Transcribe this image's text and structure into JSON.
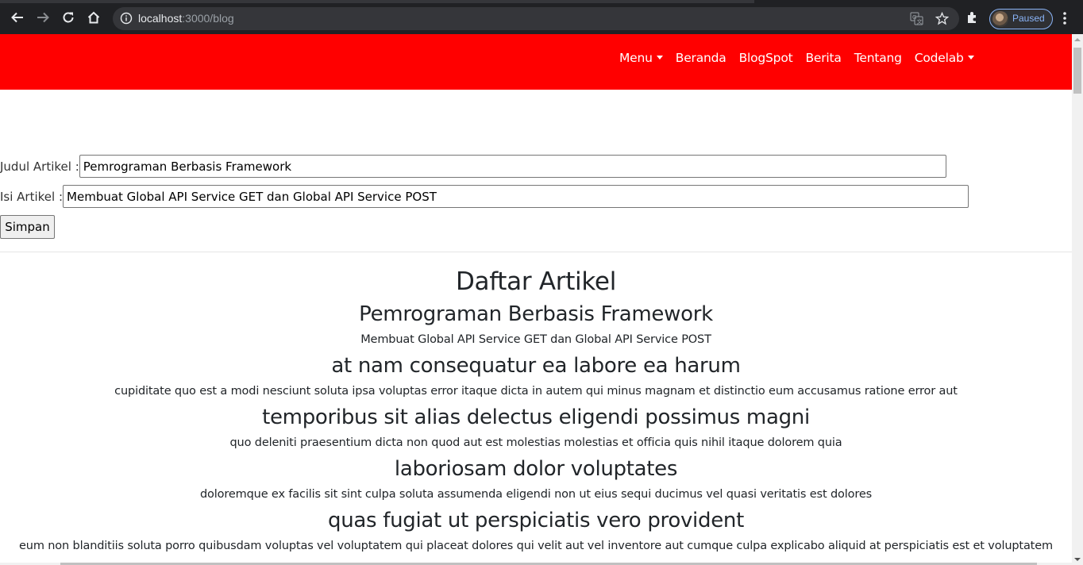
{
  "browser": {
    "url_host": "localhost",
    "url_path": ":3000/blog",
    "profile_label": "Paused",
    "icons": [
      "back-icon",
      "forward-icon",
      "reload-icon",
      "home-icon",
      "info-icon",
      "translate-icon",
      "star-icon",
      "extensions-icon",
      "avatar",
      "menu-kebab-icon"
    ]
  },
  "colors": {
    "navbar_bg": "#ff0000",
    "nav_text": "#ffffff"
  },
  "navbar": {
    "items": [
      {
        "label": "Menu",
        "dropdown": true
      },
      {
        "label": "Beranda",
        "dropdown": false
      },
      {
        "label": "BlogSpot",
        "dropdown": false
      },
      {
        "label": "Berita",
        "dropdown": false
      },
      {
        "label": "Tentang",
        "dropdown": false
      },
      {
        "label": "Codelab",
        "dropdown": true
      }
    ]
  },
  "form": {
    "title_label": "Judul Artikel :",
    "title_value": "Pemrograman Berbasis Framework",
    "body_label": "Isi Artikel :",
    "body_value": "Membuat Global API Service GET dan Global API Service POST",
    "save_label": "Simpan"
  },
  "list": {
    "heading": "Daftar Artikel",
    "articles": [
      {
        "title": "Pemrograman Berbasis Framework",
        "body": "Membuat Global API Service GET dan Global API Service POST"
      },
      {
        "title": "at nam consequatur ea labore ea harum",
        "body": "cupiditate quo est a modi nesciunt soluta ipsa voluptas error itaque dicta in autem qui minus magnam et distinctio eum accusamus ratione error aut"
      },
      {
        "title": "temporibus sit alias delectus eligendi possimus magni",
        "body": "quo deleniti praesentium dicta non quod aut est molestias molestias et officia quis nihil itaque dolorem quia"
      },
      {
        "title": "laboriosam dolor voluptates",
        "body": "doloremque ex facilis sit sint culpa soluta assumenda eligendi non ut eius sequi ducimus vel quasi veritatis est dolores"
      },
      {
        "title": "quas fugiat ut perspiciatis vero provident",
        "body": "eum non blanditiis soluta porro quibusdam voluptas vel voluptatem qui placeat dolores qui velit aut vel inventore aut cumque culpa explicabo aliquid at perspiciatis est et voluptatem"
      }
    ]
  }
}
